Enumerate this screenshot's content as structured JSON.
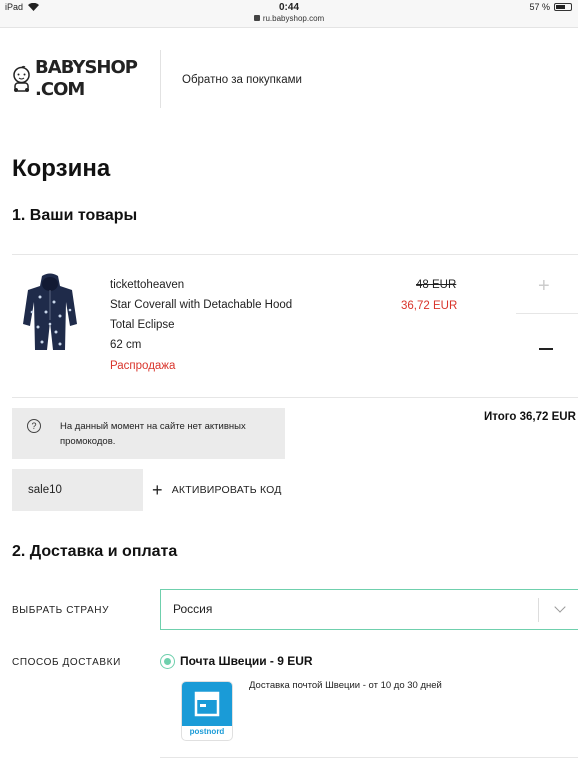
{
  "status_bar": {
    "device": "iPad",
    "time": "0:44",
    "url": "ru.babyshop.com",
    "battery": "57 %"
  },
  "header": {
    "logo_line1": "BABYSHOP",
    "logo_line2": ".COM",
    "back_link": "Обратно за покупками"
  },
  "page_title": "Корзина",
  "section1_title": "1. Ваши товары",
  "product": {
    "brand": "tickettoheaven",
    "name": "Star Coverall with Detachable Hood",
    "color": "Total Eclipse",
    "size": "62 cm",
    "badge": "Распродажа",
    "old_price": "48 EUR",
    "new_price": "36,72 EUR",
    "qty_plus": "+"
  },
  "promo_info": {
    "icon": "?",
    "text": "На данный момент на сайте нет активных промокодов."
  },
  "total": "Итого 36,72 EUR",
  "promo_code": {
    "value": "sale10",
    "activate_label": "АКТИВИРОВАТЬ КОД"
  },
  "section2_title": "2. Доставка и оплата",
  "country": {
    "label": "ВЫБРАТЬ СТРАНУ",
    "value": "Россия"
  },
  "shipping": {
    "label": "СПОСОБ ДОСТАВКИ",
    "option_name": "Почта Швеции - 9 EUR",
    "logo_label": "postnord",
    "description": "Доставка почтой Швеции - от 10 до 30 дней"
  },
  "colors": {
    "sale_red": "#d9342b",
    "accent_green": "#6fd0ad",
    "postnord_blue": "#1a9bd7"
  }
}
